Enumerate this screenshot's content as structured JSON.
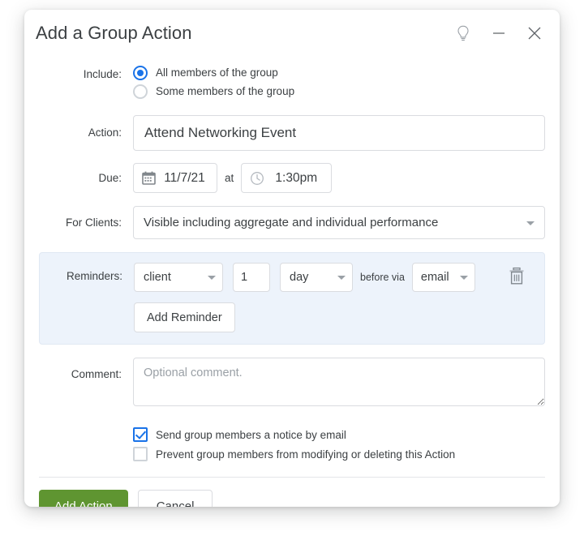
{
  "dialog": {
    "title": "Add a Group Action",
    "window_controls": [
      {
        "name": "help-lightbulb-icon",
        "label": ""
      },
      {
        "name": "minimize-icon",
        "label": ""
      },
      {
        "name": "close-icon",
        "label": ""
      }
    ]
  },
  "include": {
    "label": "Include:",
    "options": [
      {
        "label": "All members of the group",
        "checked": true
      },
      {
        "label": "Some members of the group",
        "checked": false
      }
    ]
  },
  "action": {
    "label": "Action:",
    "value": "Attend Networking Event",
    "placeholder": ""
  },
  "due": {
    "label": "Due:",
    "date": "11/7/21",
    "at": "at",
    "time": "1:30pm"
  },
  "for_clients": {
    "label": "For Clients:",
    "value": "Visible including aggregate and individual performance"
  },
  "reminders": {
    "label": "Reminders:",
    "who": "client",
    "amount": "1",
    "unit": "day",
    "before_via": "before via",
    "via": "email",
    "add_button": "Add Reminder",
    "delete_icon": "trash-icon"
  },
  "comment": {
    "label": "Comment:",
    "value": "",
    "placeholder": "Optional comment."
  },
  "checkboxes": [
    {
      "label": "Send group members a notice by email",
      "checked": true
    },
    {
      "label": "Prevent group members from modifying or deleting this Action",
      "checked": false
    }
  ],
  "footer": {
    "submit_label": "Add Action",
    "cancel_label": "Cancel"
  },
  "colors": {
    "accent_blue": "#1a73e8",
    "primary_green": "#5f9531",
    "panel_blue": "#edf3fb",
    "border_gray": "#dadce0",
    "text": "#3c4043"
  }
}
